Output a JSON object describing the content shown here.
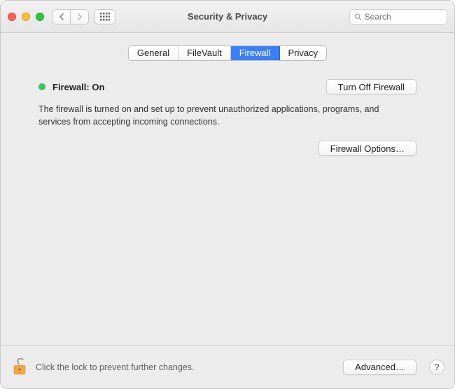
{
  "window": {
    "title": "Security & Privacy",
    "search_placeholder": "Search"
  },
  "tabs": {
    "general": "General",
    "filevault": "FileVault",
    "firewall": "Firewall",
    "privacy": "Privacy",
    "active": "firewall"
  },
  "firewall": {
    "status_label": "Firewall: On",
    "status_color": "#34c759",
    "toggle_button": "Turn Off Firewall",
    "description": "The firewall is turned on and set up to prevent unauthorized applications, programs, and services from accepting incoming connections.",
    "options_button": "Firewall Options…"
  },
  "footer": {
    "lock_text": "Click the lock to prevent further changes.",
    "advanced_button": "Advanced…",
    "help_label": "?"
  }
}
